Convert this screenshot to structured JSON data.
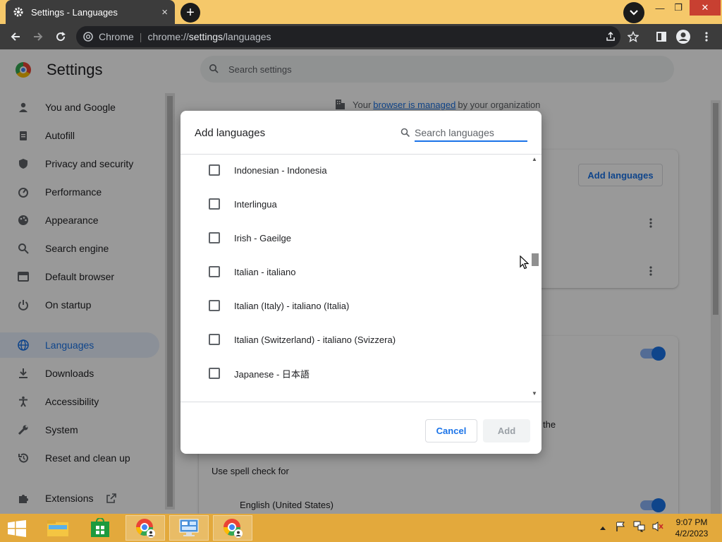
{
  "window": {
    "tab_title": "Settings - Languages",
    "tab_close": "×",
    "new_tab": "+",
    "min_label": "—",
    "max_label": "❐",
    "close_label": "✕"
  },
  "toolbar": {
    "site_label": "Chrome",
    "url_prefix": "chrome://",
    "url_host": "settings",
    "url_path": "/languages"
  },
  "settings": {
    "title": "Settings",
    "search_placeholder": "Search settings",
    "sidebar": [
      {
        "label": "You and Google",
        "icon": "person-icon"
      },
      {
        "label": "Autofill",
        "icon": "clipboard-icon"
      },
      {
        "label": "Privacy and security",
        "icon": "shield-icon"
      },
      {
        "label": "Performance",
        "icon": "speedometer-icon"
      },
      {
        "label": "Appearance",
        "icon": "palette-icon"
      },
      {
        "label": "Search engine",
        "icon": "search-icon"
      },
      {
        "label": "Default browser",
        "icon": "browser-icon"
      },
      {
        "label": "On startup",
        "icon": "power-icon"
      },
      {
        "label": "Languages",
        "icon": "globe-icon",
        "active": true
      },
      {
        "label": "Downloads",
        "icon": "download-icon"
      },
      {
        "label": "Accessibility",
        "icon": "accessibility-icon"
      },
      {
        "label": "System",
        "icon": "wrench-icon"
      },
      {
        "label": "Reset and clean up",
        "icon": "restore-icon"
      },
      {
        "label": "Extensions",
        "icon": "puzzle-icon"
      }
    ],
    "managed_prefix": "Your",
    "managed_link": "browser is managed",
    "managed_suffix": "by your organization",
    "add_languages_button": "Add languages",
    "spell_check_for": "Use spell check for",
    "spell_language": "English (United States)",
    "fragment_text": "the"
  },
  "dialog": {
    "title": "Add languages",
    "search_placeholder": "Search languages",
    "languages": [
      "Indonesian - Indonesia",
      "Interlingua",
      "Irish - Gaeilge",
      "Italian - italiano",
      "Italian (Italy) - italiano (Italia)",
      "Italian (Switzerland) - italiano (Svizzera)",
      "Japanese - 日本語"
    ],
    "cancel_label": "Cancel",
    "add_label": "Add"
  },
  "taskbar": {
    "time": "9:07 PM",
    "date": "4/2/2023"
  },
  "colors": {
    "accent": "#1a73e8",
    "titlebar": "#f5c86a",
    "taskbar": "#e3a93c"
  }
}
